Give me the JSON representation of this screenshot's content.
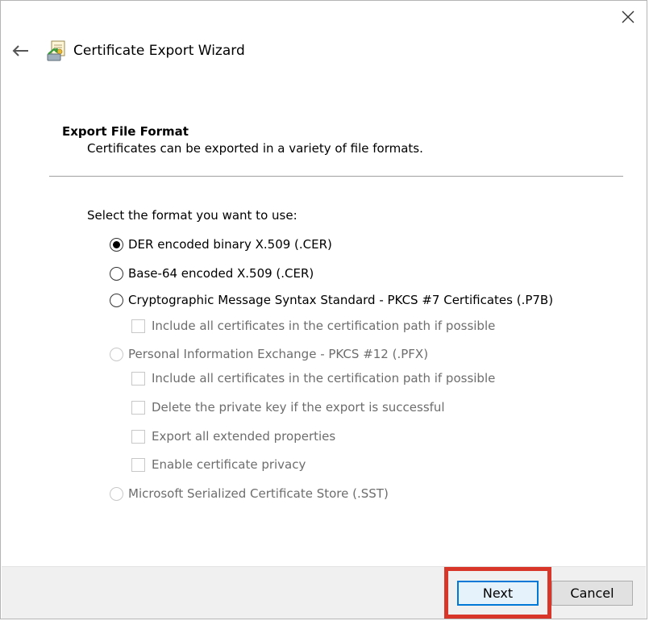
{
  "window": {
    "title": "Certificate Export Wizard",
    "icons": {
      "close": "close-icon",
      "back": "arrow-left-icon",
      "app": "certificate-icon"
    }
  },
  "section": {
    "heading": "Export File Format",
    "description": "Certificates can be exported in a variety of file formats."
  },
  "form": {
    "prompt": "Select the format you want to use:",
    "options": [
      {
        "label": "DER encoded binary X.509 (.CER)",
        "selected": true,
        "enabled": true
      },
      {
        "label": "Base-64 encoded X.509 (.CER)",
        "selected": false,
        "enabled": true
      },
      {
        "label": "Cryptographic Message Syntax Standard - PKCS #7 Certificates (.P7B)",
        "selected": false,
        "enabled": true
      },
      {
        "label": "Personal Information Exchange - PKCS #12 (.PFX)",
        "selected": false,
        "enabled": false
      },
      {
        "label": "Microsoft Serialized Certificate Store (.SST)",
        "selected": false,
        "enabled": false
      }
    ],
    "p7b_checkboxes": [
      {
        "label": "Include all certificates in the certification path if possible",
        "checked": false,
        "enabled": false
      }
    ],
    "pfx_checkboxes": [
      {
        "label": "Include all certificates in the certification path if possible",
        "checked": false,
        "enabled": false
      },
      {
        "label": "Delete the private key if the export is successful",
        "checked": false,
        "enabled": false
      },
      {
        "label": "Export all extended properties",
        "checked": false,
        "enabled": false
      },
      {
        "label": "Enable certificate privacy",
        "checked": false,
        "enabled": false
      }
    ]
  },
  "footer": {
    "next_label": "Next",
    "cancel_label": "Cancel"
  },
  "colors": {
    "accent": "#0078d7",
    "highlight": "#d9362a",
    "disabled_text": "#6d6d6d",
    "footer_bg": "#f0f0f0"
  }
}
